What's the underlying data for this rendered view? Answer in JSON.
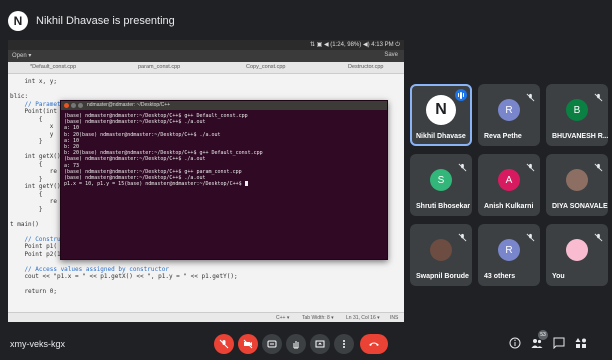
{
  "presenter": {
    "initial": "N",
    "banner": "Nikhil Dhavase is presenting"
  },
  "shared_screen": {
    "ubuntu_status": "⇅ ▣ ◀ (1:24, 98%) ◀) 4:13 PM ⏻",
    "toolbar_left": "Open ▾",
    "toolbar_right": "Save",
    "tabs": [
      "*Default_const.cpp",
      "param_const.cpp",
      "Copy_const.cpp",
      "Destructor.cpp"
    ],
    "code_lines": [
      "    int x, y;",
      "",
      "blic:",
      "    // Parameterized Constructor",
      "    Point(int",
      "        {",
      "           x",
      "           y",
      "        }",
      "",
      "    int getX()",
      "        {",
      "           re",
      "        }",
      "    int getY()",
      "        {",
      "           re",
      "        }",
      "",
      "t main()",
      "",
      "    // Constru",
      "    Point p1(",
      "    Point p2(10, 15);",
      "",
      "    // Access values assigned by constructor",
      "    cout << \"p1.x = \" << p1.getX() << \", p1.y = \" << p1.getY();",
      "",
      "    return 0;"
    ],
    "editor_status": {
      "lang": "C++ ▾",
      "tab_width": "Tab Width: 8 ▾",
      "position": "Ln 31, Col 16 ▾",
      "mode": "INS"
    },
    "terminal_title": "ndmaster@ndmaster: ~/Desktop/C++",
    "terminal_lines": [
      "(base) ndmaster@ndmaster:~/Desktop/C++$ g++ Default_const.cpp",
      "(base) ndmaster@ndmaster:~/Desktop/C++$ ./a.out",
      "a: 10",
      "b: 20(base) ndmaster@ndmaster:~/Desktop/C++$ ./a.out",
      "a: 10",
      "b: 20",
      "b: 20(base) ndmaster@ndmaster:~/Desktop/C++$ g++ Default_const.cpp",
      "(base) ndmaster@ndmaster:~/Desktop/C++$ ./a.out",
      "a: 73",
      "(base) ndmaster@ndmaster:~/Desktop/C++$ g++ param_const.cpp",
      "(base) ndmaster@ndmaster:~/Desktop/C++$ ./a.out",
      "p1.x = 10, p1.y = 15(base) ndmaster@ndmaster:~/Desktop/C++$ "
    ]
  },
  "participants": [
    {
      "name": "Nikhil Dhavase",
      "initial": "N",
      "color": "#ffffff",
      "text_color": "#202124",
      "speaking": true
    },
    {
      "name": "Reva Pethe",
      "initial": "R",
      "color": "#7986cb",
      "text_color": "#ffffff",
      "speaking": false
    },
    {
      "name": "BHUVANESH R...",
      "initial": "B",
      "color": "#0b8043",
      "text_color": "#ffffff",
      "speaking": false
    },
    {
      "name": "Shruti Bhosekar",
      "initial": "S",
      "color": "#33b679",
      "text_color": "#ffffff",
      "speaking": false
    },
    {
      "name": "Anish Kulkarni",
      "initial": "A",
      "color": "#d81b60",
      "text_color": "#ffffff",
      "speaking": false
    },
    {
      "name": "DIYA SONAVALE",
      "initial": "",
      "color": "#8d6e63",
      "text_color": "#ffffff",
      "speaking": false
    },
    {
      "name": "Swapnil Borude",
      "initial": "",
      "color": "#6d4c41",
      "text_color": "#ffffff",
      "speaking": false
    },
    {
      "name": "43 others",
      "initial": "R",
      "color": "#7986cb",
      "text_color": "#ffffff",
      "speaking": false
    },
    {
      "name": "You",
      "initial": "",
      "color": "#f8bbd0",
      "text_color": "#ffffff",
      "speaking": false
    }
  ],
  "meeting": {
    "code": "xmy-veks-kgx",
    "people_count": "53"
  },
  "colors": {
    "accent": "#8ab4f8",
    "danger": "#ea4335",
    "background": "#202124",
    "tile": "#3c4043"
  }
}
